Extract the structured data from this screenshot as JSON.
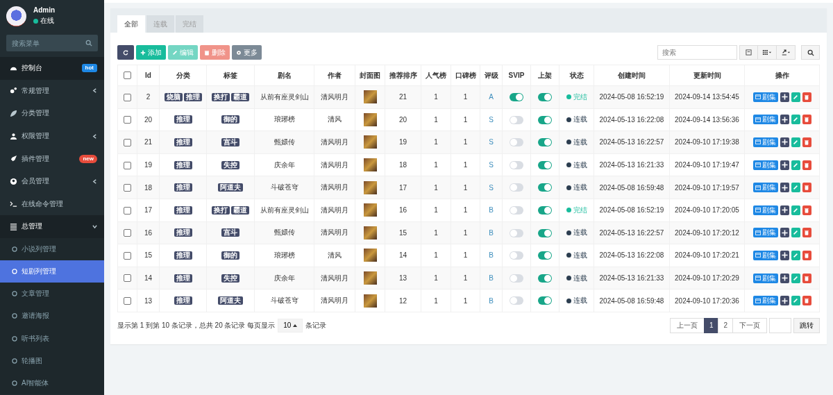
{
  "user": {
    "name": "Admin",
    "status": "在线",
    "online": true
  },
  "sidebar": {
    "search_placeholder": "搜索菜单",
    "items": [
      {
        "label": "控制台",
        "badge": {
          "text": "hot",
          "color": "#1e88e5"
        }
      },
      {
        "label": "常规管理",
        "expanded": false
      },
      {
        "label": "分类管理"
      },
      {
        "label": "权限管理",
        "expanded": false
      },
      {
        "label": "插件管理",
        "badge": {
          "text": "new",
          "color": "#e74c3c"
        }
      },
      {
        "label": "会员管理",
        "expanded": false
      },
      {
        "label": "在线命令管理"
      },
      {
        "label": "总管理",
        "expanded": true,
        "children": [
          {
            "label": "小说列管理",
            "selected": false
          },
          {
            "label": "短剧列管理",
            "selected": true
          },
          {
            "label": "文章管理",
            "selected": false
          },
          {
            "label": "邀请海报",
            "selected": false
          },
          {
            "label": "听书列表",
            "selected": false
          },
          {
            "label": "轮播图",
            "selected": false
          },
          {
            "label": "AI智能体",
            "selected": false
          }
        ]
      }
    ]
  },
  "tabs": [
    {
      "label": "全部",
      "selected": true
    },
    {
      "label": "连载",
      "selected": false
    },
    {
      "label": "完结",
      "selected": false
    }
  ],
  "toolbar": [
    {
      "kind": "refresh",
      "disabled": false
    },
    {
      "kind": "add",
      "label": "添加",
      "disabled": false
    },
    {
      "kind": "edit",
      "label": "编辑",
      "disabled": true
    },
    {
      "kind": "delete",
      "label": "删除",
      "disabled": true
    },
    {
      "kind": "more",
      "label": "更多",
      "disabled": false
    }
  ],
  "search": {
    "placeholder": "搜索"
  },
  "table": {
    "all_checked": false,
    "columns": [
      "Id",
      "分类",
      "标签",
      "剧名",
      "作者",
      "封面图",
      "推荐排序",
      "人气榜",
      "口碑榜",
      "评级",
      "SVIP",
      "上架",
      "状态",
      "创建时间",
      "更新时间",
      "操作"
    ],
    "rows": [
      {
        "checked": false,
        "id": "2",
        "categories": [
          "烧脑",
          "推理"
        ],
        "tags": [
          "换打",
          "霸道"
        ],
        "title": "从前有座灵剑山",
        "author": "清风明月",
        "sort": "21",
        "popularity": "1",
        "reputation": "1",
        "rating": "A",
        "svip": true,
        "on_shelf": true,
        "status": {
          "text": "完结",
          "color": "#18bc9c"
        },
        "created": "2024-05-08 16:52:19",
        "updated": "2024-09-14 13:54:45",
        "action": "剧集"
      },
      {
        "checked": false,
        "id": "20",
        "categories": [
          "推理"
        ],
        "tags": [
          "御的"
        ],
        "title": "琅琊榜",
        "author": "清风",
        "sort": "20",
        "popularity": "1",
        "reputation": "1",
        "rating": "S",
        "svip": false,
        "on_shelf": true,
        "status": {
          "text": "连载",
          "color": "#2c3e50"
        },
        "created": "2024-05-13 16:22:08",
        "updated": "2024-09-14 13:56:36",
        "action": "剧集"
      },
      {
        "checked": false,
        "id": "21",
        "categories": [
          "推理"
        ],
        "tags": [
          "宫斗"
        ],
        "title": "甄嬛传",
        "author": "清风明月",
        "sort": "19",
        "popularity": "1",
        "reputation": "1",
        "rating": "S",
        "svip": false,
        "on_shelf": true,
        "status": {
          "text": "连载",
          "color": "#2c3e50"
        },
        "created": "2024-05-13 16:22:57",
        "updated": "2024-09-10 17:19:38",
        "action": "剧集"
      },
      {
        "checked": false,
        "id": "19",
        "categories": [
          "推理"
        ],
        "tags": [
          "失控"
        ],
        "title": "庆余年",
        "author": "清风明月",
        "sort": "18",
        "popularity": "1",
        "reputation": "1",
        "rating": "S",
        "svip": false,
        "on_shelf": true,
        "status": {
          "text": "连载",
          "color": "#2c3e50"
        },
        "created": "2024-05-13 16:21:33",
        "updated": "2024-09-10 17:19:47",
        "action": "剧集"
      },
      {
        "checked": false,
        "id": "18",
        "categories": [
          "推理"
        ],
        "tags": [
          "阿道夫"
        ],
        "title": "斗破苍穹",
        "author": "清风明月",
        "sort": "17",
        "popularity": "1",
        "reputation": "1",
        "rating": "S",
        "svip": false,
        "on_shelf": true,
        "status": {
          "text": "连载",
          "color": "#2c3e50"
        },
        "created": "2024-05-08 16:59:48",
        "updated": "2024-09-10 17:19:57",
        "action": "剧集"
      },
      {
        "checked": false,
        "id": "17",
        "categories": [
          "推理"
        ],
        "tags": [
          "换打",
          "霸道"
        ],
        "title": "从前有座灵剑山",
        "author": "清风明月",
        "sort": "16",
        "popularity": "1",
        "reputation": "1",
        "rating": "B",
        "svip": false,
        "on_shelf": true,
        "status": {
          "text": "完结",
          "color": "#18bc9c"
        },
        "created": "2024-05-08 16:52:19",
        "updated": "2024-09-10 17:20:05",
        "action": "剧集"
      },
      {
        "checked": false,
        "id": "16",
        "categories": [
          "推理"
        ],
        "tags": [
          "宫斗"
        ],
        "title": "甄嬛传",
        "author": "清风明月",
        "sort": "15",
        "popularity": "1",
        "reputation": "1",
        "rating": "B",
        "svip": false,
        "on_shelf": true,
        "status": {
          "text": "连载",
          "color": "#2c3e50"
        },
        "created": "2024-05-13 16:22:57",
        "updated": "2024-09-10 17:20:12",
        "action": "剧集"
      },
      {
        "checked": false,
        "id": "15",
        "categories": [
          "推理"
        ],
        "tags": [
          "御的"
        ],
        "title": "琅琊榜",
        "author": "清风",
        "sort": "14",
        "popularity": "1",
        "reputation": "1",
        "rating": "B",
        "svip": false,
        "on_shelf": true,
        "status": {
          "text": "连载",
          "color": "#2c3e50"
        },
        "created": "2024-05-13 16:22:08",
        "updated": "2024-09-10 17:20:21",
        "action": "剧集"
      },
      {
        "checked": false,
        "id": "14",
        "categories": [
          "推理"
        ],
        "tags": [
          "失控"
        ],
        "title": "庆余年",
        "author": "清风明月",
        "sort": "13",
        "popularity": "1",
        "reputation": "1",
        "rating": "B",
        "svip": false,
        "on_shelf": true,
        "status": {
          "text": "连载",
          "color": "#2c3e50"
        },
        "created": "2024-05-13 16:21:33",
        "updated": "2024-09-10 17:20:29",
        "action": "剧集"
      },
      {
        "checked": false,
        "id": "13",
        "categories": [
          "推理"
        ],
        "tags": [
          "阿道夫"
        ],
        "title": "斗破苍穹",
        "author": "清风明月",
        "sort": "12",
        "popularity": "1",
        "reputation": "1",
        "rating": "B",
        "svip": false,
        "on_shelf": true,
        "status": {
          "text": "连载",
          "color": "#2c3e50"
        },
        "created": "2024-05-08 16:59:48",
        "updated": "2024-09-10 17:20:36",
        "action": "剧集"
      }
    ]
  },
  "footer": {
    "summary": "显示第 1 到第 10 条记录，总共 20 条记录 每页显示",
    "page_size": "10",
    "suffix": "条记录"
  },
  "pagination": {
    "prev": "上一页",
    "pages": [
      {
        "label": "1",
        "selected": true
      },
      {
        "label": "2",
        "selected": false
      }
    ],
    "next": "下一页",
    "jump": "跳转"
  }
}
